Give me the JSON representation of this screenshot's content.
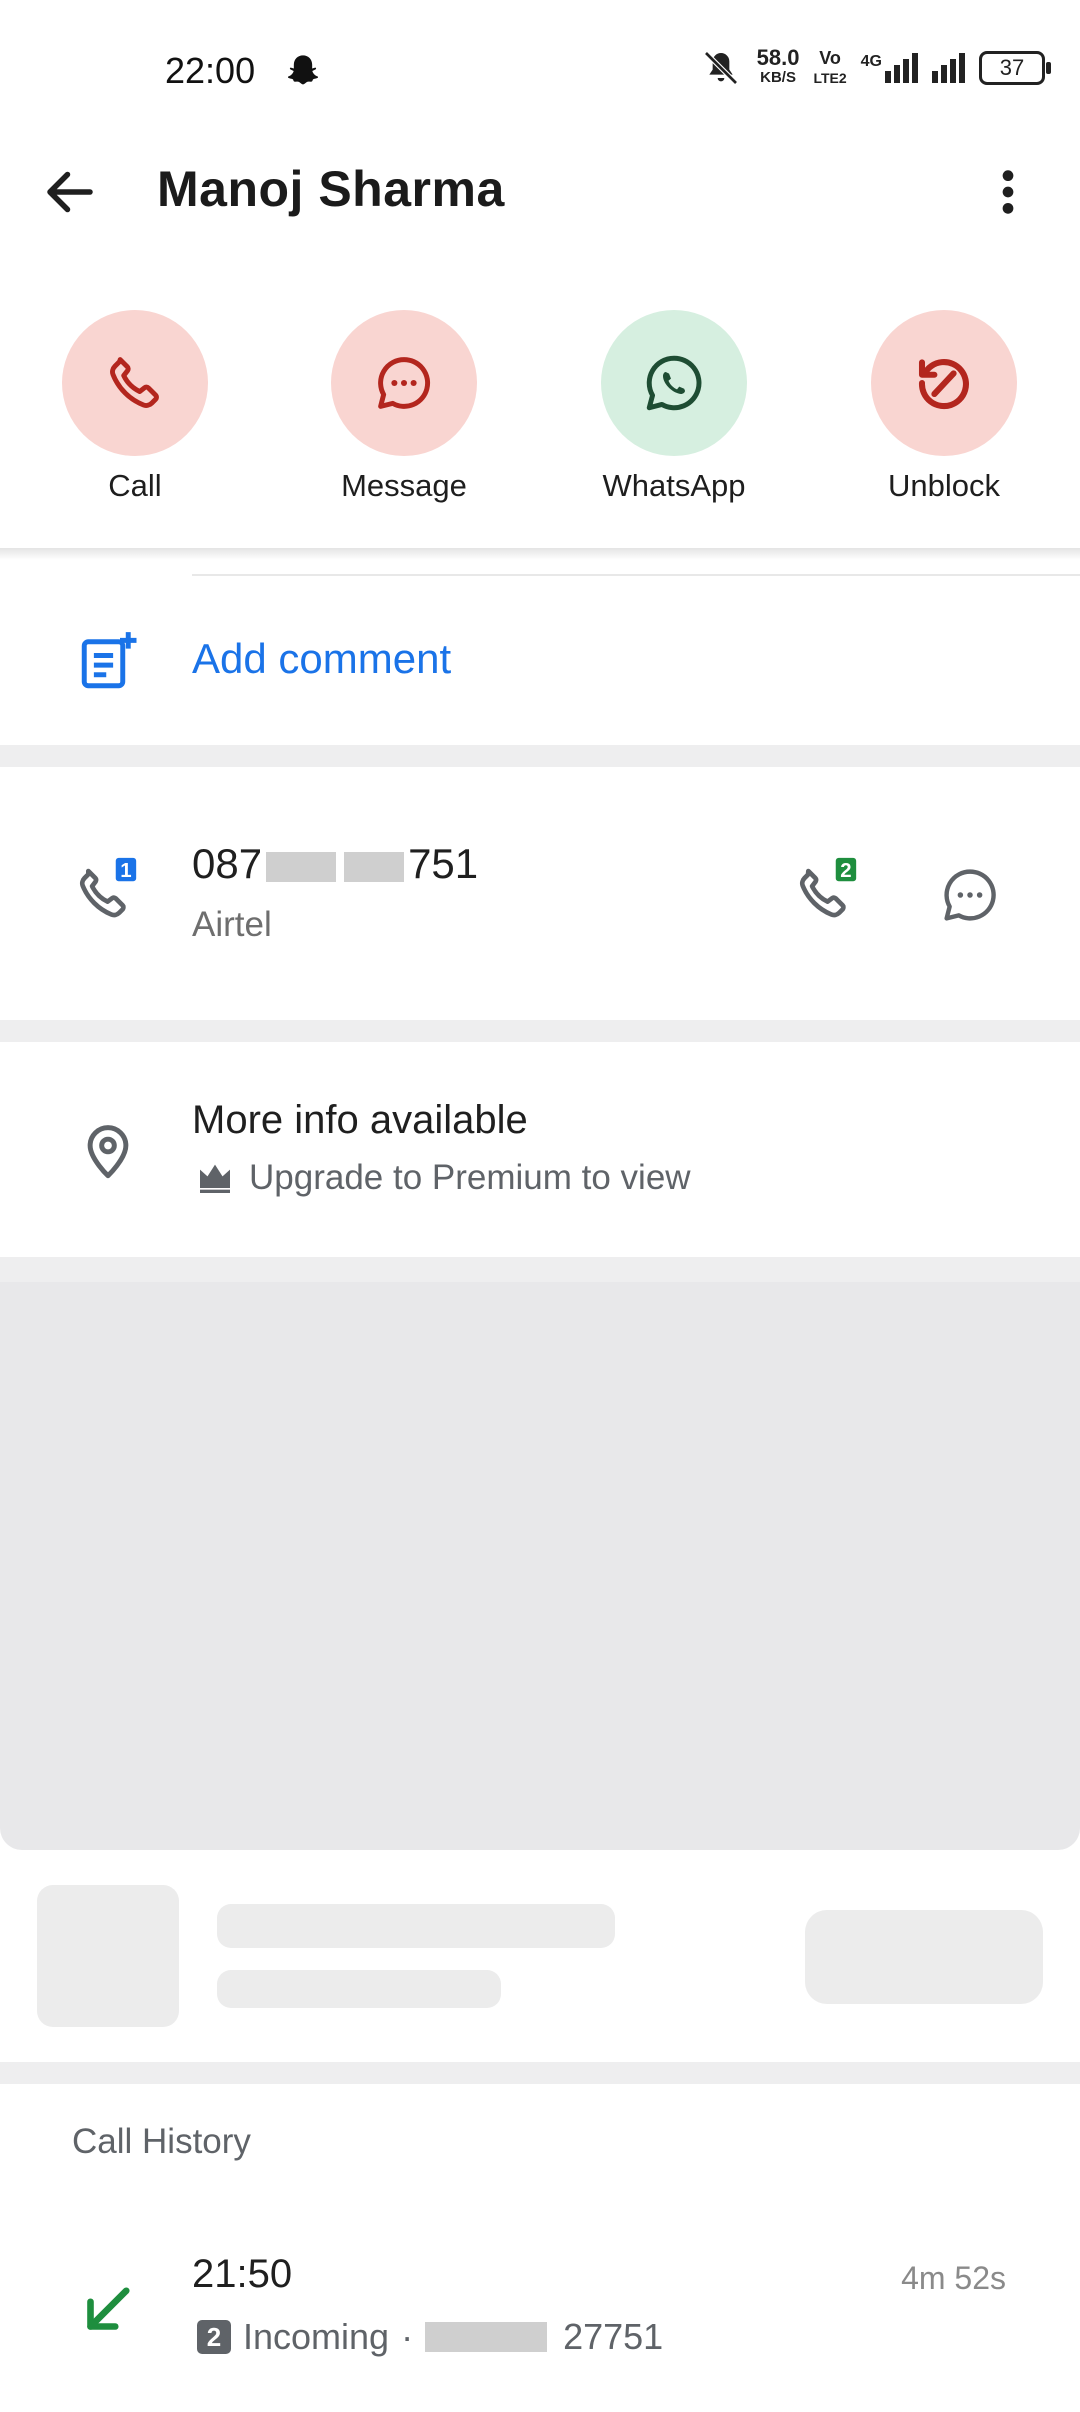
{
  "status_bar": {
    "time": "22:00",
    "speed_value": "58.0",
    "speed_unit": "KB/S",
    "volte_top": "Vo",
    "volte_bottom": "LTE2",
    "network": "4G",
    "battery": "37"
  },
  "header": {
    "title": "Manoj Sharma"
  },
  "actions": [
    {
      "label": "Call",
      "color": "#b3261e",
      "bg": "#f9d5d1"
    },
    {
      "label": "Message",
      "color": "#b3261e",
      "bg": "#f9d5d1"
    },
    {
      "label": "WhatsApp",
      "color": "#1e4d33",
      "bg": "#d6efe0"
    },
    {
      "label": "Unblock",
      "color": "#b3261e",
      "bg": "#f9d5d1"
    }
  ],
  "comment": {
    "label": "Add comment"
  },
  "phone": {
    "number_prefix": "087",
    "number_suffix": "751",
    "carrier": "Airtel",
    "sim1": "1",
    "sim2": "2"
  },
  "more_info": {
    "title": "More info available",
    "subtitle": "Upgrade to Premium to view"
  },
  "call_history": {
    "title": "Call History",
    "entries": [
      {
        "time": "21:50",
        "sim": "2",
        "type": "Incoming",
        "separator": "·",
        "number_suffix": "27751",
        "duration": "4m 52s"
      }
    ]
  },
  "colors": {
    "accent_blue": "#1a73e8",
    "incoming_green": "#1e8e3e",
    "sim1_blue": "#1a73e8",
    "sim2_green": "#1e8e3e"
  }
}
